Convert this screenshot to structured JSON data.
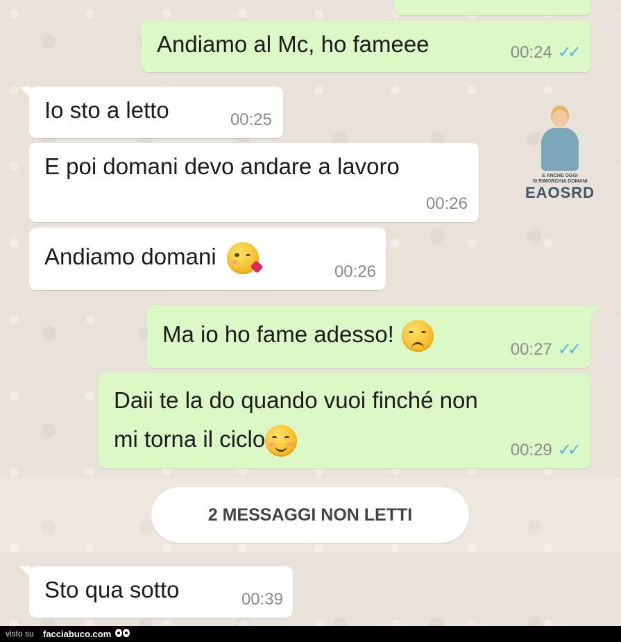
{
  "messages": [
    {
      "text": "",
      "time": "",
      "read": ""
    },
    {
      "text": "Andiamo al Mc, ho fameee",
      "time": "00:24",
      "read": "✓✓"
    },
    {
      "text": "Io sto a letto",
      "time": "00:25"
    },
    {
      "text": "E poi domani devo andare a lavoro",
      "time": "00:26"
    },
    {
      "text": "Andiamo domani",
      "time": "00:26",
      "emoji": "kissing-wink-emoji"
    },
    {
      "text": "Ma io ho fame adesso!",
      "time": "00:27",
      "read": "✓✓",
      "emoji": "unamused-emoji"
    },
    {
      "text_line1": "Daii te la do quando vuoi finché non",
      "text_line2": "mi torna il ciclo",
      "time": "00:29",
      "read": "✓✓",
      "emoji": "smiling-emoji"
    },
    {
      "text": "Sto qua sotto",
      "time": "00:39"
    }
  ],
  "unread_divider": "2 MESSAGGI NON LETTI",
  "watermark": {
    "small_line1": "E ANCHE OGGI",
    "small_line2": "SI RIMORCHIA DOMANI",
    "brand": "EAOSRD"
  },
  "footer": {
    "visto_su": "visto su",
    "site": "facciabuco.com"
  },
  "colors": {
    "outgoing_bubble": "#dcf8c6",
    "incoming_bubble": "#ffffff",
    "read_ticks": "#4fb6ec",
    "wallpaper": "#e9e2d8"
  }
}
